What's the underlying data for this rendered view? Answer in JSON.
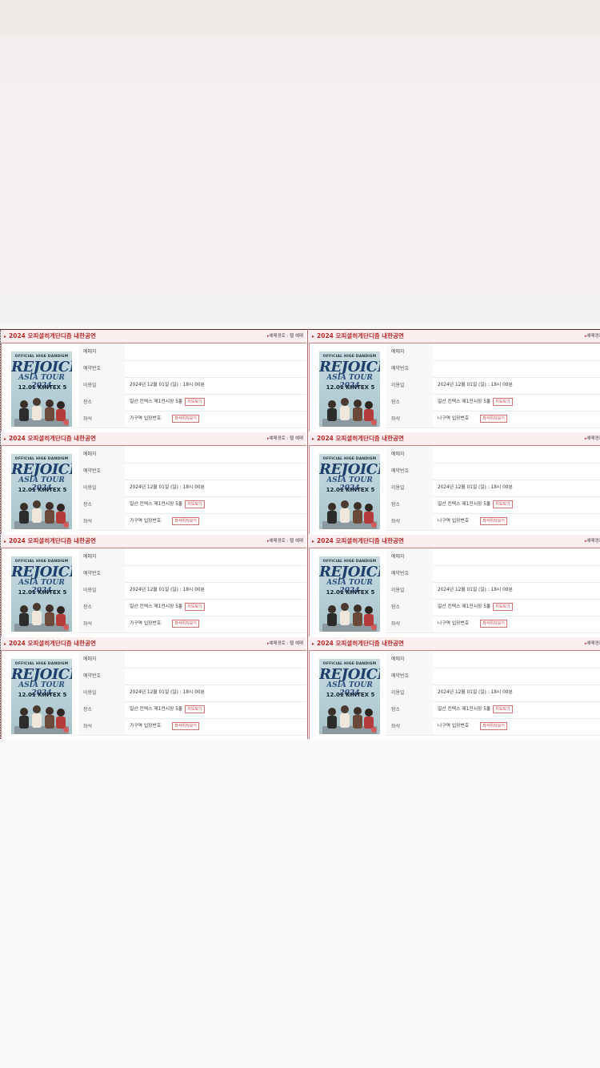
{
  "cards": [
    {
      "title": "2024 오피셜히게단디즘 내한공연",
      "route": "예매경로 : 웹 예매",
      "labels": [
        "예매자",
        "예약번호",
        "이용일",
        "장소",
        "좌석"
      ],
      "date": "2024년 12월 01일 (일) : 18시 00분",
      "venue": "일산 킨텍스 제1전시장 5홀",
      "map_btn": "지도보기",
      "seat": "가구역 입장번호",
      "seat_btn": "좌석위치보기"
    },
    {
      "title": "2024 오피셜히게단디즘 내한공연",
      "route": "예매경로 : 웹",
      "labels": [
        "예매자",
        "예약번호",
        "이용일",
        "장소",
        "좌석"
      ],
      "date": "2024년 12월 01일 (일) : 18시 00분",
      "venue": "일산 킨텍스 제1전시장 5홀",
      "map_btn": "지도보기",
      "seat": "나구역 입장번호",
      "seat_btn": "좌석위치보기"
    },
    {
      "title": "2024 오피셜히게단디즘 내한공연",
      "route": "예매경로 : 웹 예매",
      "labels": [
        "예매자",
        "예약번호",
        "이용일",
        "장소",
        "좌석"
      ],
      "date": "2024년 12월 01일 (일) : 18시 00분",
      "venue": "일산 킨텍스 제1전시장 5홀",
      "map_btn": "지도보기",
      "seat": "가구역 입장번호",
      "seat_btn": "좌석위치보기"
    },
    {
      "title": "2024 오피셜히게단디즘 내한공연",
      "route": "예매경로 : 웹",
      "labels": [
        "예매자",
        "예약번호",
        "이용일",
        "장소",
        "좌석"
      ],
      "date": "2024년 12월 01일 (일) : 18시 00분",
      "venue": "일산 킨텍스 제1전시장 5홀",
      "map_btn": "지도보기",
      "seat": "나구역 입장번호",
      "seat_btn": "좌석위치보기"
    },
    {
      "title": "2024 오피셜히게단디즘 내한공연",
      "route": "예매경로 : 웹 예매",
      "labels": [
        "예매자",
        "예약번호",
        "이용일",
        "장소",
        "좌석"
      ],
      "date": "2024년 12월 01일 (일) : 18시 00분",
      "venue": "일산 킨텍스 제1전시장 5홀",
      "map_btn": "지도보기",
      "seat": "가구역 입장번호",
      "seat_btn": "좌석위치보기"
    },
    {
      "title": "2024 오피셜히게단디즘 내한공연",
      "route": "예매경로 : 웹",
      "labels": [
        "예매자",
        "예약번호",
        "이용일",
        "장소",
        "좌석"
      ],
      "date": "2024년 12월 01일 (일) : 18시 00분",
      "venue": "일산 킨텍스 제1전시장 5홀",
      "map_btn": "지도보기",
      "seat": "나구역 입장번호",
      "seat_btn": "좌석위치보기"
    },
    {
      "title": "2024 오피셜히게단디즘 내한공연",
      "route": "예매경로 : 웹 예매",
      "labels": [
        "예매자",
        "예약번호",
        "이용일",
        "장소",
        "좌석"
      ],
      "date": "2024년 12월 01일 (일) : 18시 00분",
      "venue": "일산 킨텍스 제1전시장 5홀",
      "map_btn": "지도보기",
      "seat": "가구역 입장번호",
      "seat_btn": "좌석위치보기"
    },
    {
      "title": "2024 오피셜히게단디즘 내한공연",
      "route": "예매경로 : 웹",
      "labels": [
        "예매자",
        "예약번호",
        "이용일",
        "장소",
        "좌석"
      ],
      "date": "2024년 12월 01일 (일) : 18시 00분",
      "venue": "일산 킨텍스 제1전시장 5홀",
      "map_btn": "지도보기",
      "seat": "나구역 입장번호",
      "seat_btn": "좌석위치보기"
    }
  ],
  "poster": {
    "line1": "OFFICIAL HIGE DANDISM",
    "line2": "REJOICE",
    "line3": "ASIA TOUR 2024",
    "line4": "12.01 KINTEX 5"
  },
  "colors": {
    "accent": "#b42b2b",
    "header_bg": "#fbeeee",
    "border": "#c98080"
  }
}
